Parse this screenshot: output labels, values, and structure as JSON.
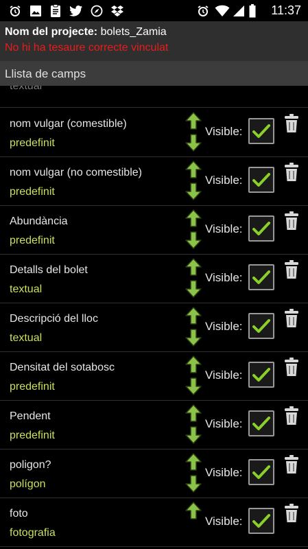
{
  "statusbar": {
    "time": "11:37",
    "icons": [
      "alarm-icon",
      "image-icon",
      "clipboard-icon",
      "twitter-icon",
      "compass-icon",
      "dropbox-icon",
      "alarm-clock-icon",
      "wifi-icon",
      "signal-icon",
      "battery-icon"
    ]
  },
  "project": {
    "name_label": "Nom del projecte:",
    "name_value": "bolets_Zamia",
    "warning": "No hi ha tesaure correcte vinculat"
  },
  "section": {
    "title": "Llista de camps"
  },
  "partial_item": {
    "type": "textual"
  },
  "visible_label": "Visible:",
  "fields": [
    {
      "name": "nom vulgar (comestible)",
      "type": "predefinit",
      "visible": true,
      "has_up": true,
      "has_down": true
    },
    {
      "name": "nom vulgar (no comestible)",
      "type": "predefinit",
      "visible": true,
      "has_up": true,
      "has_down": true
    },
    {
      "name": "Abundància",
      "type": "predefinit",
      "visible": true,
      "has_up": true,
      "has_down": true
    },
    {
      "name": "Detalls del bolet",
      "type": "textual",
      "visible": true,
      "has_up": true,
      "has_down": true
    },
    {
      "name": "Descripció del lloc",
      "type": "textual",
      "visible": true,
      "has_up": true,
      "has_down": true
    },
    {
      "name": "Densitat del sotabosc",
      "type": "predefinit",
      "visible": true,
      "has_up": true,
      "has_down": true
    },
    {
      "name": "Pendent",
      "type": "predefinit",
      "visible": true,
      "has_up": true,
      "has_down": true
    },
    {
      "name": "poligon?",
      "type": "polígon",
      "visible": true,
      "has_up": true,
      "has_down": true
    },
    {
      "name": "foto",
      "type": "fotografia",
      "visible": true,
      "has_up": true,
      "has_down": false
    }
  ],
  "colors": {
    "type_text": "#c9e05a",
    "warning": "#e81c1c",
    "arrow_green": "#8bc34a",
    "check_green": "#8bd02a"
  }
}
